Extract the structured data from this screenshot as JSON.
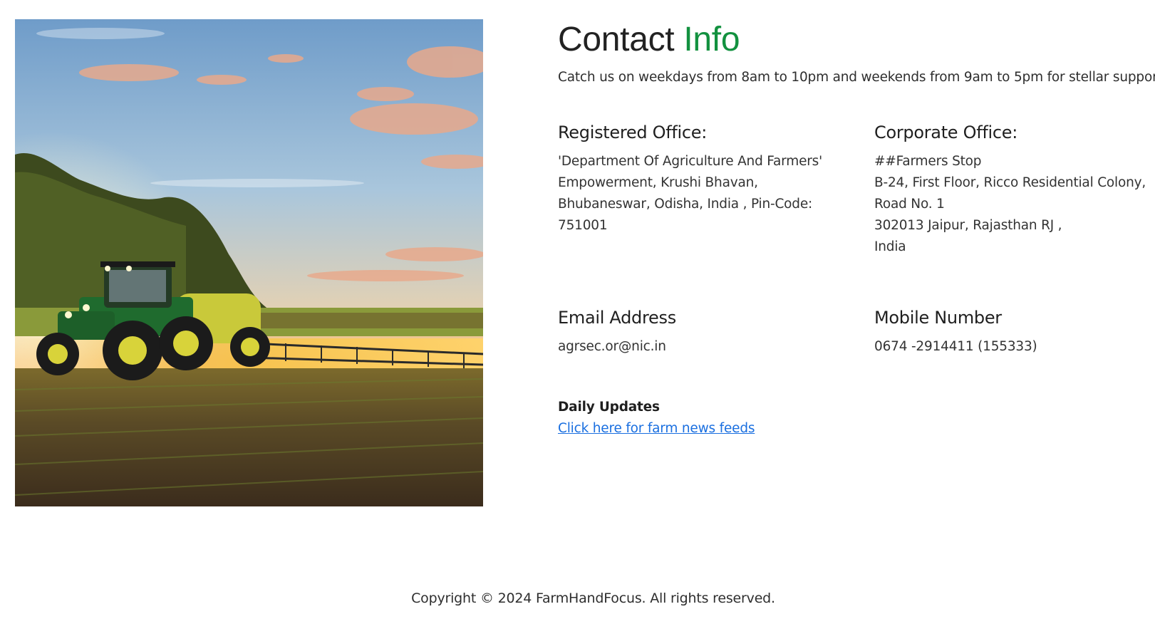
{
  "hero": {
    "image_name": "tractor-field-sunset-image"
  },
  "contact": {
    "title_main": "Contact",
    "title_accent": "Info",
    "subtitle": "Catch us on weekdays from 8am to 10pm and weekends from 9am to 5pm for stellar support!",
    "accent_color": "#12913f"
  },
  "registered_office": {
    "heading": "Registered Office:",
    "lines": [
      "'Department Of Agriculture And Farmers'",
      "Empowerment, Krushi Bhavan,",
      "Bhubaneswar, Odisha, India , Pin-Code:",
      "751001"
    ]
  },
  "corporate_office": {
    "heading": "Corporate Office:",
    "lines": [
      "##Farmers Stop",
      "B-24, First Floor, Ricco Residential Colony,",
      "Road No. 1",
      "302013 Jaipur, Rajasthan RJ ,",
      "India"
    ]
  },
  "email": {
    "heading": "Email Address",
    "value": "agrsec.or@nic.in"
  },
  "mobile": {
    "heading": "Mobile Number",
    "value": "0674 -2914411 (155333)"
  },
  "updates": {
    "heading": "Daily Updates",
    "link_text": "Click here for farm news feeds",
    "link_color": "#1a6fe0"
  },
  "footer": {
    "copyright": "Copyright © 2024 FarmHandFocus. All rights reserved."
  }
}
